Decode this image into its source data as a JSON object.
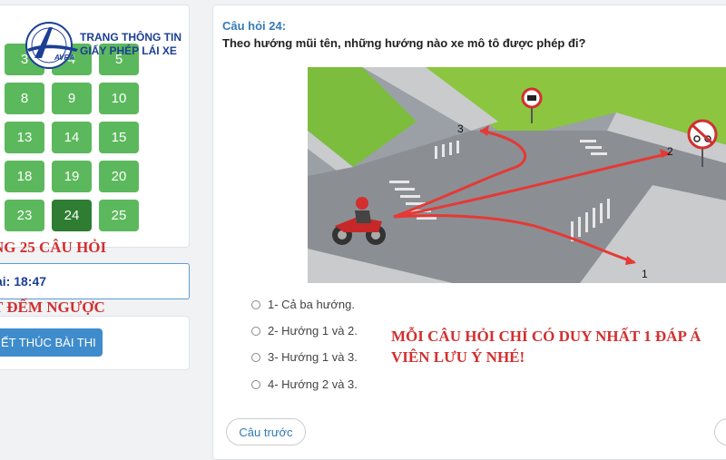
{
  "brand": {
    "line1": "TRANG THÔNG TIN",
    "line2": "GIẤY PHÉP LÁI XE",
    "logo_text": "AVRA"
  },
  "grid": {
    "items": [
      {
        "label": "3",
        "state": "done"
      },
      {
        "label": "4",
        "state": "done"
      },
      {
        "label": "5",
        "state": "done"
      },
      {
        "label": "8",
        "state": "done"
      },
      {
        "label": "9",
        "state": "done"
      },
      {
        "label": "10",
        "state": "done"
      },
      {
        "label": "13",
        "state": "done"
      },
      {
        "label": "14",
        "state": "done"
      },
      {
        "label": "15",
        "state": "done"
      },
      {
        "label": "18",
        "state": "done"
      },
      {
        "label": "19",
        "state": "done"
      },
      {
        "label": "20",
        "state": "done"
      },
      {
        "label": "23",
        "state": "done"
      },
      {
        "label": "24",
        "state": "current"
      },
      {
        "label": "25",
        "state": "done"
      }
    ],
    "caption": "NG 25 CÂU HỎI"
  },
  "timer": {
    "text": "ại: 18:47",
    "caption": "T ĐẾM NGƯỢC"
  },
  "finish_button": "ẾT THÚC BÀI THI",
  "question": {
    "number": "Câu hỏi 24:",
    "text": "Theo hướng mũi tên, những hướng nào xe mô tô được phép đi?",
    "image": {
      "arrow_labels": [
        "1",
        "2",
        "3"
      ]
    },
    "answers": [
      "1- Cả ba hướng.",
      "2- Hướng 1 và 2.",
      "3- Hướng 1 và 3.",
      "4- Hướng 2 và 3."
    ],
    "note_line1": "MỖI CÂU HỎI CHỈ CÓ DUY NHẤT 1 ĐÁP Á",
    "note_line2": "VIÊN LƯU Ý NHÉ!",
    "prev_button": "Câu trước"
  },
  "colors": {
    "answered": "#5cb85c",
    "current": "#2e7d32",
    "caption_red": "#d32f2f",
    "brand_blue": "#1c3f95"
  }
}
